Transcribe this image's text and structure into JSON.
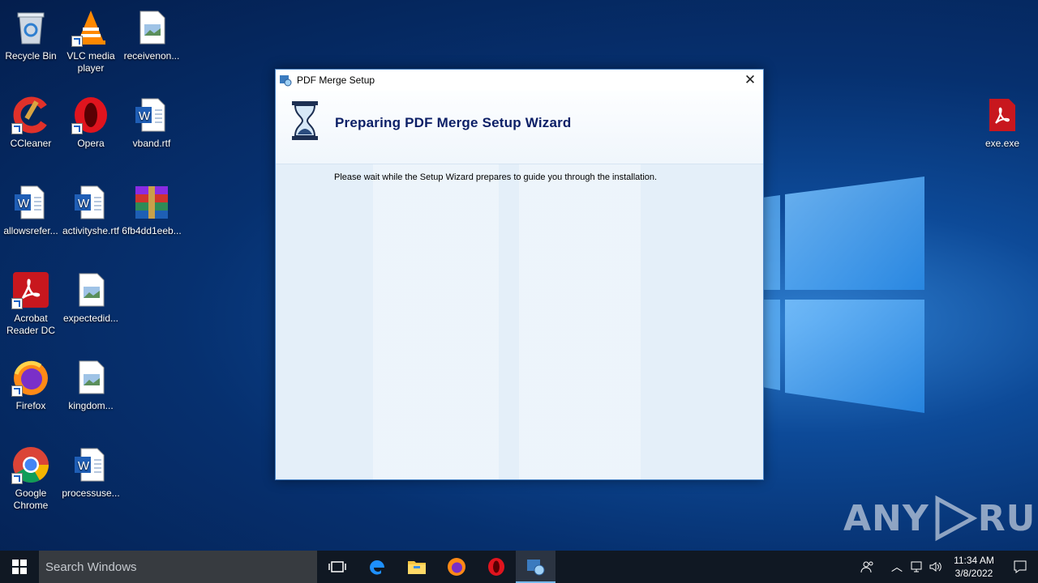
{
  "desktop": {
    "icons": [
      {
        "label": "Recycle Bin"
      },
      {
        "label": "VLC media player"
      },
      {
        "label": "receivenon..."
      },
      {
        "label": "CCleaner"
      },
      {
        "label": "Opera"
      },
      {
        "label": "vband.rtf"
      },
      {
        "label": "allowsrefer..."
      },
      {
        "label": "activityshe.rtf"
      },
      {
        "label": "6fb4dd1eeb..."
      },
      {
        "label": "Acrobat Reader DC"
      },
      {
        "label": "expectedid..."
      },
      {
        "label": "Firefox"
      },
      {
        "label": "kingdom..."
      },
      {
        "label": "Google Chrome"
      },
      {
        "label": "processuse..."
      },
      {
        "label": "exe.exe"
      }
    ]
  },
  "dialog": {
    "title": "PDF Merge Setup",
    "heading": "Preparing PDF Merge Setup Wizard",
    "message": "Please wait while the Setup Wizard prepares to guide you through the installation."
  },
  "taskbar": {
    "search_placeholder": "Search Windows",
    "time": "11:34 AM",
    "date": "3/8/2022",
    "items": [
      "task-view",
      "edge",
      "file-explorer",
      "firefox",
      "opera",
      "pdf-merge-setup"
    ]
  },
  "watermark": {
    "text_left": "ANY",
    "text_right": "RUN"
  },
  "colors": {
    "taskbar": "#101823",
    "accent": "#76b9ed",
    "dialog_heading": "#0c1f66"
  }
}
